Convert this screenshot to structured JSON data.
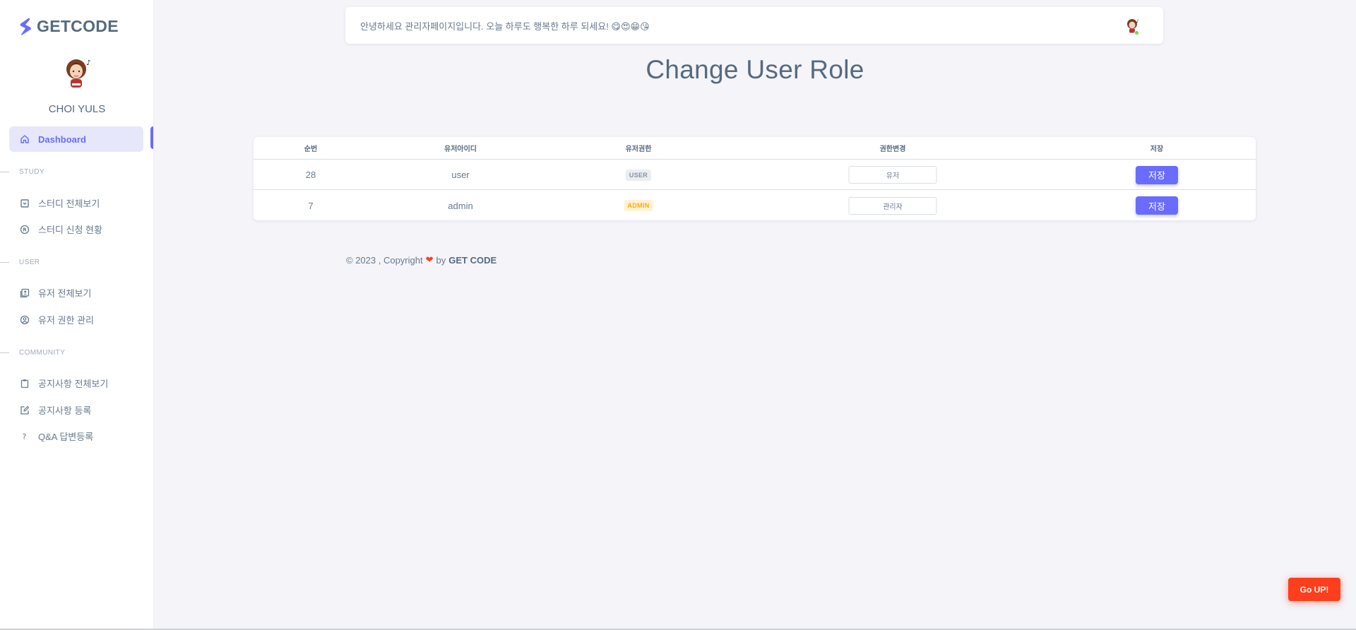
{
  "brand": {
    "name": "GETCODE",
    "color": "#696cff"
  },
  "profile": {
    "name": "CHOI YULS"
  },
  "sidebar": {
    "active": {
      "label": "Dashboard",
      "icon": "home-icon"
    },
    "sections": [
      {
        "header": "STUDY",
        "items": [
          {
            "label": "스터디 전체보기",
            "icon": "box-icon"
          },
          {
            "label": "스터디 신청 현황",
            "icon": "registered-icon"
          }
        ]
      },
      {
        "header": "USER",
        "items": [
          {
            "label": "유저 전체보기",
            "icon": "user-list-icon"
          },
          {
            "label": "유저 권한 관리",
            "icon": "user-circle-icon"
          }
        ]
      },
      {
        "header": "COMMUNITY",
        "items": [
          {
            "label": "공지사항 전체보기",
            "icon": "clipboard-icon"
          },
          {
            "label": "공지사항 등록",
            "icon": "edit-icon"
          },
          {
            "label": "Q&A 답변등록",
            "icon": "question-icon"
          }
        ]
      }
    ]
  },
  "topbar": {
    "greeting": "안녕하세요 관리자페이지입니다. 오늘 하루도 행복한 하루 되세요! 😋😍😁😘"
  },
  "page": {
    "title": "Change User Role"
  },
  "table": {
    "headers": [
      "순번",
      "유저아이디",
      "유저권한",
      "권한변경",
      "저장"
    ],
    "rows": [
      {
        "no": "28",
        "user_id": "user",
        "role": "USER",
        "role_select": "유저",
        "save": "저장"
      },
      {
        "no": "7",
        "user_id": "admin",
        "role": "ADMIN",
        "role_select": "관리자",
        "save": "저장"
      }
    ]
  },
  "footer": {
    "prefix": "© 2023 , Copyright",
    "by": "by",
    "brand": "GET CODE"
  },
  "go_up": {
    "label": "Go UP!"
  }
}
